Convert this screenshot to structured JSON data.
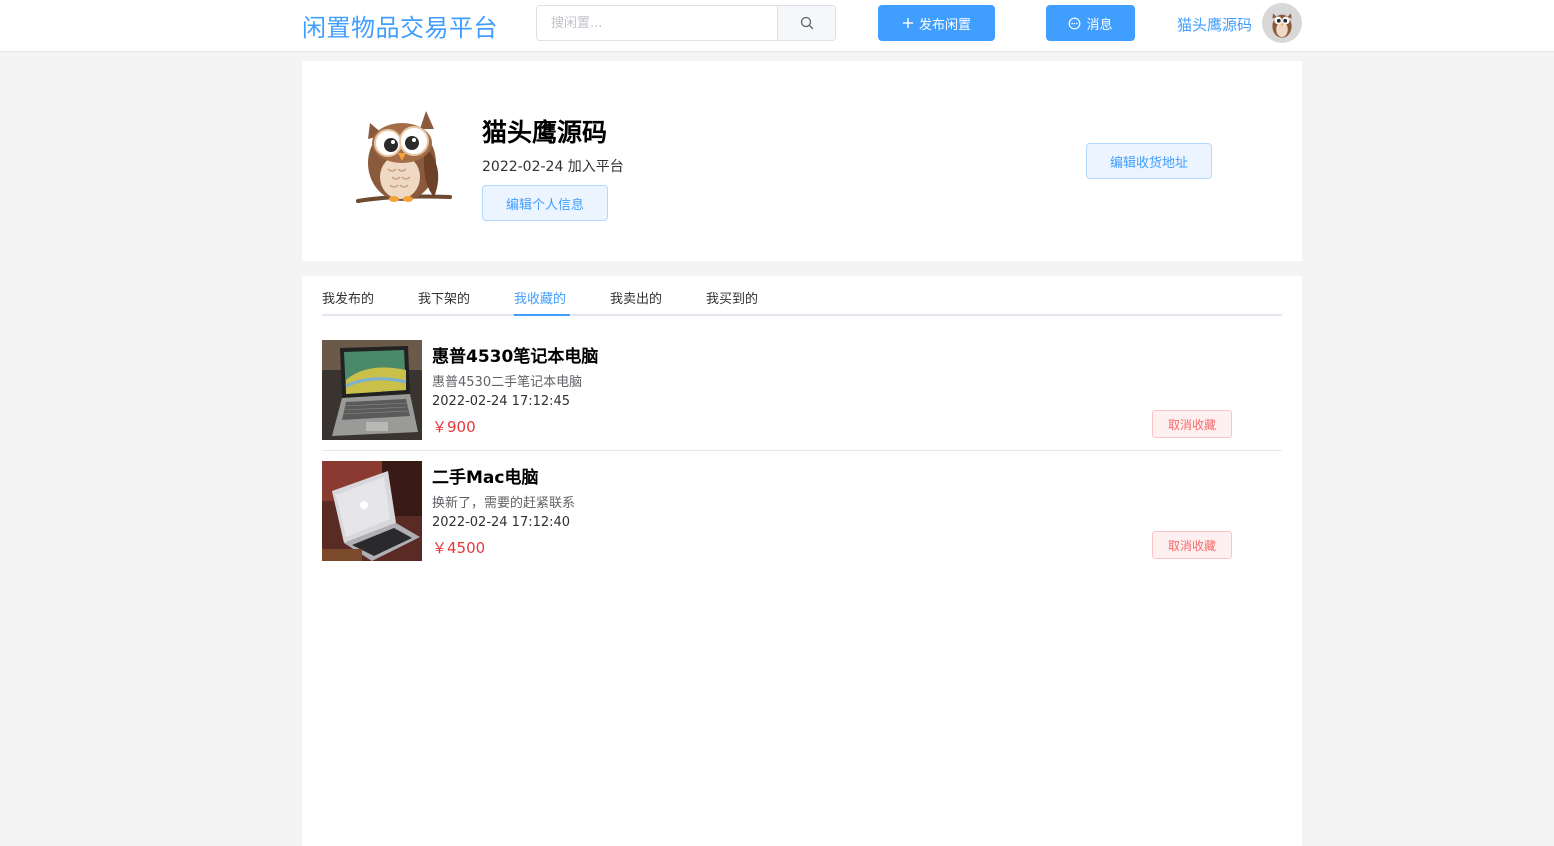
{
  "header": {
    "logo": "闲置物品交易平台",
    "search_placeholder": "搜闲置...",
    "publish_label": "发布闲置",
    "message_label": "消息",
    "user_name": "猫头鹰源码"
  },
  "profile": {
    "name": "猫头鹰源码",
    "join_text": "2022-02-24 加入平台",
    "edit_info_label": "编辑个人信息",
    "edit_address_label": "编辑收货地址"
  },
  "tabs": [
    {
      "label": "我发布的"
    },
    {
      "label": "我下架的"
    },
    {
      "label": "我收藏的",
      "active": true
    },
    {
      "label": "我卖出的"
    },
    {
      "label": "我买到的"
    }
  ],
  "items": [
    {
      "title": "惠普4530笔记本电脑",
      "desc": "惠普4530二手笔记本电脑",
      "time": "2022-02-24 17:12:45",
      "price": "￥900",
      "action": "取消收藏"
    },
    {
      "title": "二手Mac电脑",
      "desc": "换新了，需要的赶紧联系",
      "time": "2022-02-24 17:12:40",
      "price": "￥4500",
      "action": "取消收藏"
    }
  ],
  "colors": {
    "accent": "#409eff",
    "price": "#e4393c",
    "danger": "#f56c6c"
  }
}
